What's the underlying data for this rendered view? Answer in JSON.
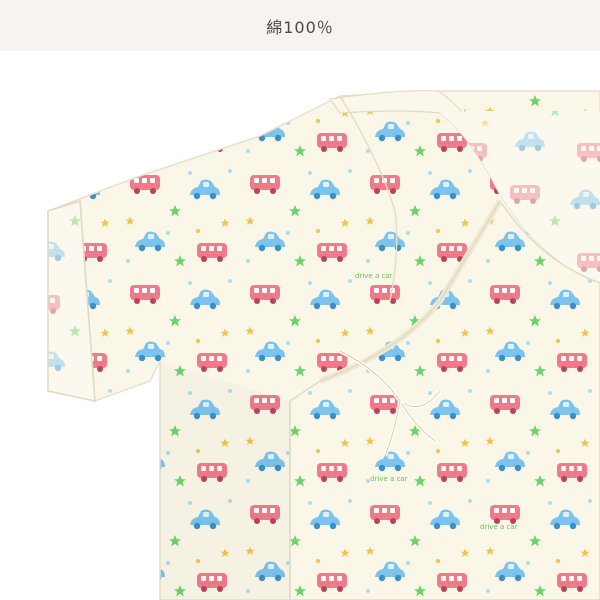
{
  "header": {
    "title": "綿100％"
  },
  "photo": {
    "description_icon": "baby-kimono-garment-photo",
    "print_text": "drive a car",
    "colors": {
      "fabric": "#fbf7e8",
      "bus": "#f07a8a",
      "car": "#7cc4ee",
      "star_green": "#6cd36c",
      "star_yellow": "#f2c24a",
      "dot": "#a9dcef"
    }
  }
}
